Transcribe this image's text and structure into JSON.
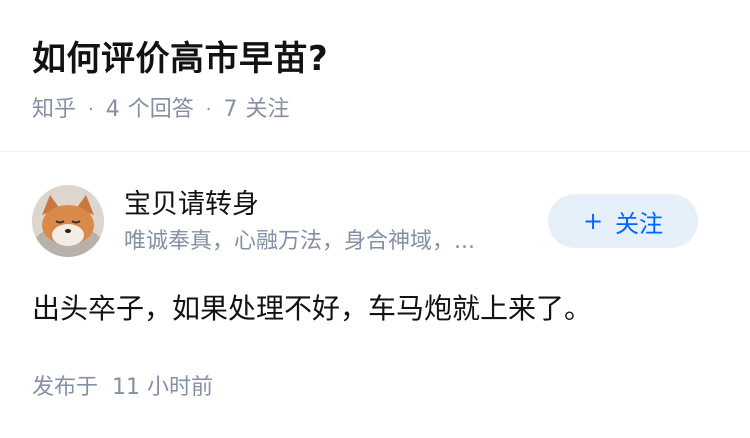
{
  "question": {
    "title": "如何评价高市早苗?",
    "source": "知乎",
    "separator": "·",
    "answers_count": "4",
    "answers_label": "个回答",
    "follow_count": "7",
    "follow_label": "关注"
  },
  "answer": {
    "author_name": "宝贝请转身",
    "author_bio": "唯诚奉真，心融万法，身合神域，...",
    "follow_button": {
      "plus": "+",
      "label": "关注"
    },
    "content": "出头卒子，如果处理不好，车马炮就上来了。",
    "posted_label": "发布于",
    "posted_time": "11 小时前"
  },
  "colors": {
    "accent": "#0066ff",
    "follow_bg": "#e6f0fa",
    "meta": "#8590a6",
    "text": "#121212"
  }
}
